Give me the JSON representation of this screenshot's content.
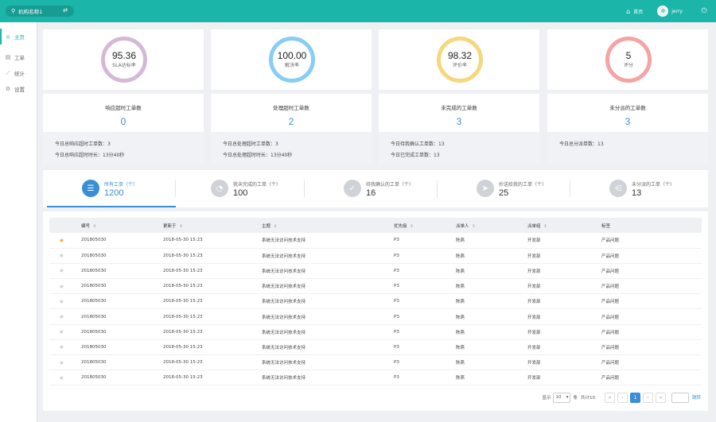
{
  "topbar": {
    "org_name": "机构名称1",
    "home_label": "首页",
    "username": "jerry"
  },
  "sidebar": {
    "items": [
      {
        "label": "主页",
        "icon": "home-icon",
        "active": true
      },
      {
        "label": "工单",
        "icon": "ticket-icon",
        "active": false
      },
      {
        "label": "统计",
        "icon": "chart-icon",
        "active": false
      },
      {
        "label": "设置",
        "icon": "gear-icon",
        "active": false
      }
    ]
  },
  "kpis": [
    {
      "value": "95.36",
      "label": "SLA达标率",
      "color": "#d4b9d6"
    },
    {
      "value": "100.00",
      "label": "解决率",
      "color": "#87cdf5"
    },
    {
      "value": "98.32",
      "label": "评价率",
      "color": "#f6d77c"
    },
    {
      "value": "5",
      "label": "评分",
      "color": "#f5a3a3"
    }
  ],
  "overview": [
    {
      "title": "响应超时工单数",
      "count": "0",
      "lines": [
        "今日总响应超时工单数：3",
        "今日总响应超时时长：13分40秒"
      ]
    },
    {
      "title": "处理超时工单数",
      "count": "2",
      "lines": [
        "今日总处理超时工单数：3",
        "今日总处理超时时长：13分40秒"
      ]
    },
    {
      "title": "未完成的工单数",
      "count": "3",
      "lines": [
        "今日待我确认工单数：13",
        "今日已完成工单数：13"
      ]
    },
    {
      "title": "未分派的工单数",
      "count": "3",
      "lines": [
        "今日总分派单数：13"
      ]
    }
  ],
  "filters": [
    {
      "label": "所有工单（个）",
      "count": "1200",
      "icon": "list-icon",
      "glyph": "☰",
      "active": true
    },
    {
      "label": "我未完成的工单（个）",
      "count": "100",
      "icon": "clock-icon",
      "glyph": "◔",
      "active": false
    },
    {
      "label": "待我确认的工单（个）",
      "count": "16",
      "icon": "check-icon",
      "glyph": "✓",
      "active": false
    },
    {
      "label": "抄送给我的工单（个）",
      "count": "25",
      "icon": "send-icon",
      "glyph": "➤",
      "active": false
    },
    {
      "label": "未分派的工单（个）",
      "count": "13",
      "icon": "share-icon",
      "glyph": "⋲",
      "active": false
    }
  ],
  "table": {
    "headers": [
      "编号",
      "更新于",
      "主题",
      "优先级",
      "派单人",
      "派单组",
      "标签"
    ],
    "rows": [
      {
        "starred": true,
        "cells": [
          "201805030",
          "2018-05-30  15:23",
          "系统无法访问技术支持",
          "P3",
          "陈燕",
          "开发部",
          "产品问题"
        ]
      },
      {
        "starred": false,
        "cells": [
          "201805030",
          "2018-05-30  15:23",
          "系统无法访问技术支持",
          "P3",
          "陈燕",
          "开发部",
          "产品问题"
        ]
      },
      {
        "starred": false,
        "cells": [
          "201805030",
          "2018-05-30  15:23",
          "系统无法访问技术支持",
          "P3",
          "陈燕",
          "开发部",
          "产品问题"
        ]
      },
      {
        "starred": false,
        "cells": [
          "201805030",
          "2018-05-30  15:23",
          "系统无法访问技术支持",
          "P3",
          "陈燕",
          "开发部",
          "产品问题"
        ]
      },
      {
        "starred": false,
        "cells": [
          "201805030",
          "2018-05-30  15:23",
          "系统无法访问技术支持",
          "P3",
          "陈燕",
          "开发部",
          "产品问题"
        ]
      },
      {
        "starred": false,
        "cells": [
          "201805030",
          "2018-05-30  15:23",
          "系统无法访问技术支持",
          "P3",
          "陈燕",
          "开发部",
          "产品问题"
        ]
      },
      {
        "starred": false,
        "cells": [
          "201805030",
          "2018-05-30  15:23",
          "系统无法访问技术支持",
          "P3",
          "陈燕",
          "开发部",
          "产品问题"
        ]
      },
      {
        "starred": false,
        "cells": [
          "201805030",
          "2018-05-30  15:23",
          "系统无法访问技术支持",
          "P3",
          "陈燕",
          "开发部",
          "产品问题"
        ]
      },
      {
        "starred": false,
        "cells": [
          "201805030",
          "2018-05-30  15:23",
          "系统无法访问技术支持",
          "P3",
          "陈燕",
          "开发部",
          "产品问题"
        ]
      },
      {
        "starred": false,
        "cells": [
          "201805030",
          "2018-05-30  15:23",
          "系统无法访问技术支持",
          "P3",
          "陈燕",
          "开发部",
          "产品问题"
        ]
      }
    ]
  },
  "pagination": {
    "show_label": "显示",
    "page_size": "10",
    "unit_label": "条",
    "total_label": "共计10",
    "current_page": "1",
    "go_label": "跳转"
  }
}
